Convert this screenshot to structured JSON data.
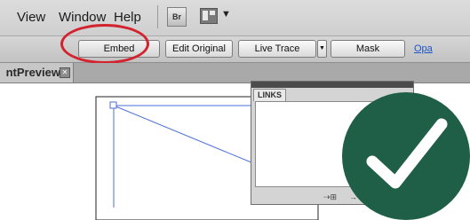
{
  "menubar": {
    "items": [
      "View",
      "Window",
      "Help"
    ],
    "bridge_label": "Br"
  },
  "controlbar": {
    "embed_label": "Embed",
    "edit_original_label": "Edit Original",
    "live_trace_label": "Live Trace",
    "mask_label": "Mask",
    "overflow_link": "Opa"
  },
  "document_tab": {
    "title": "ntPreview",
    "close_glyph": "✕"
  },
  "links_panel": {
    "title": "LINKS",
    "footer_icons": [
      "⇢⊞",
      "→",
      "⊡"
    ]
  },
  "colors": {
    "highlight": "#d3232e",
    "check_badge": "#1f5f48",
    "link_accent": "#1c54c9",
    "artwork_line": "#4a6fd8"
  },
  "icons": {
    "bridge": "bridge-icon",
    "workspace": "workspace-switcher-icon",
    "check": "checkmark-icon"
  }
}
